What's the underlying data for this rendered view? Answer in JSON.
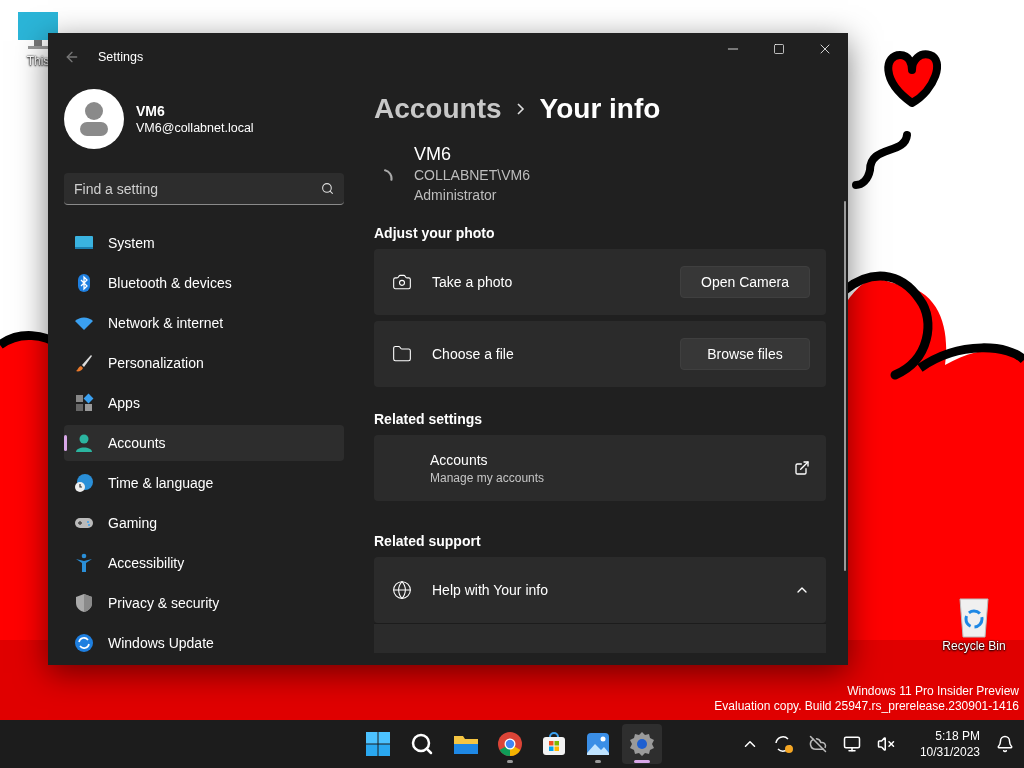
{
  "desktop": {
    "icons": [
      {
        "kind": "pc",
        "label": "This"
      },
      {
        "kind": "bin",
        "label": "Recycle Bin"
      }
    ],
    "watermark": [
      "Windows 11 Pro Insider Preview",
      "Evaluation copy. Build 25947.rs_prerelease.230901-1416"
    ]
  },
  "window": {
    "title": "Settings"
  },
  "profile": {
    "name": "VM6",
    "email": "VM6@collabnet.local"
  },
  "search": {
    "placeholder": "Find a setting"
  },
  "nav": [
    {
      "label": "System",
      "selected": false
    },
    {
      "label": "Bluetooth & devices",
      "selected": false
    },
    {
      "label": "Network & internet",
      "selected": false
    },
    {
      "label": "Personalization",
      "selected": false
    },
    {
      "label": "Apps",
      "selected": false
    },
    {
      "label": "Accounts",
      "selected": true
    },
    {
      "label": "Time & language",
      "selected": false
    },
    {
      "label": "Gaming",
      "selected": false
    },
    {
      "label": "Accessibility",
      "selected": false
    },
    {
      "label": "Privacy & security",
      "selected": false
    },
    {
      "label": "Windows Update",
      "selected": false
    }
  ],
  "breadcrumb": [
    "Accounts",
    "Your info"
  ],
  "user": {
    "name": "VM6",
    "account": "COLLABNET\\VM6",
    "role": "Administrator"
  },
  "sections": [
    {
      "heading": "Adjust your photo",
      "cards": [
        {
          "kind": "action",
          "label": "Take a photo",
          "button": "Open Camera"
        },
        {
          "kind": "action",
          "label": "Choose a file",
          "button": "Browse files"
        }
      ]
    },
    {
      "heading": "Related settings",
      "cards": [
        {
          "kind": "link",
          "title": "Accounts",
          "subtitle": "Manage my accounts"
        }
      ]
    },
    {
      "heading": "Related support",
      "cards": [
        {
          "kind": "expander",
          "label": "Help with Your info",
          "expanded": true
        }
      ]
    }
  ],
  "taskbar": {
    "apps": [
      {
        "running": false,
        "selected": false
      },
      {
        "running": false,
        "selected": false
      },
      {
        "running": false,
        "selected": false
      },
      {
        "running": true,
        "selected": false
      },
      {
        "running": false,
        "selected": false
      },
      {
        "running": true,
        "selected": false
      },
      {
        "running": true,
        "selected": true
      }
    ],
    "clock": {
      "time": "5:18 PM",
      "date": "10/31/2023"
    }
  }
}
